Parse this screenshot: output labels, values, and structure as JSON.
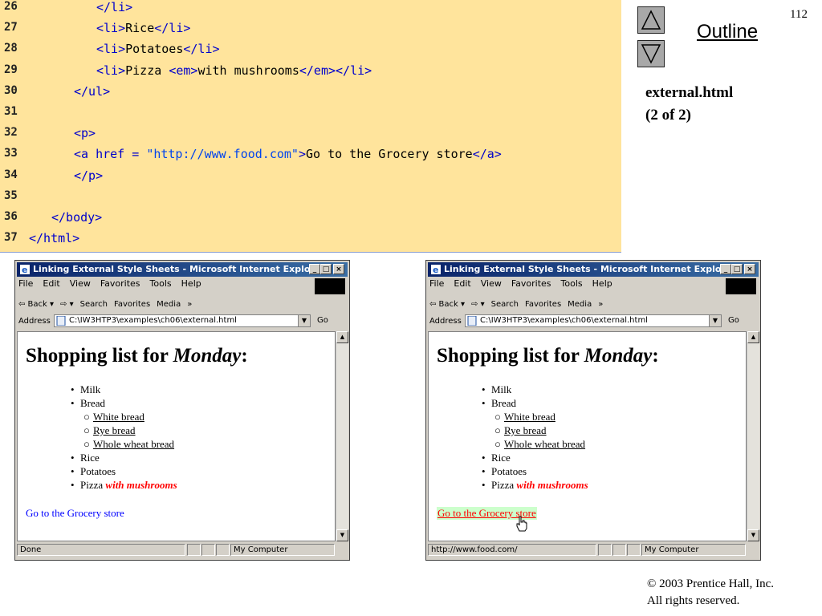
{
  "code": {
    "lines": [
      {
        "num": "26",
        "indent": 120,
        "parts": [
          {
            "t": "</li>",
            "c": "tag"
          }
        ]
      },
      {
        "num": "27",
        "indent": 120,
        "parts": [
          {
            "t": "<li>",
            "c": "tag"
          },
          {
            "t": "Rice",
            "c": "txt"
          },
          {
            "t": "</li>",
            "c": "tag"
          }
        ]
      },
      {
        "num": "28",
        "indent": 120,
        "parts": [
          {
            "t": "<li>",
            "c": "tag"
          },
          {
            "t": "Potatoes",
            "c": "txt"
          },
          {
            "t": "</li>",
            "c": "tag"
          }
        ]
      },
      {
        "num": "29",
        "indent": 120,
        "parts": [
          {
            "t": "<li>",
            "c": "tag"
          },
          {
            "t": "Pizza ",
            "c": "txt"
          },
          {
            "t": "<em>",
            "c": "tag"
          },
          {
            "t": "with mushrooms",
            "c": "txt"
          },
          {
            "t": "</em></li>",
            "c": "tag"
          }
        ]
      },
      {
        "num": "30",
        "indent": 92,
        "parts": [
          {
            "t": "</ul>",
            "c": "tag"
          }
        ]
      },
      {
        "num": "31",
        "indent": 92,
        "parts": []
      },
      {
        "num": "32",
        "indent": 92,
        "parts": [
          {
            "t": "<p>",
            "c": "tag"
          }
        ]
      },
      {
        "num": "33",
        "indent": 92,
        "parts": [
          {
            "t": "<a href = ",
            "c": "attr"
          },
          {
            "t": "\"http://www.food.com\"",
            "c": "str"
          },
          {
            "t": ">",
            "c": "tag"
          },
          {
            "t": "Go to the Grocery store",
            "c": "txt"
          },
          {
            "t": "</a>",
            "c": "tag"
          }
        ]
      },
      {
        "num": "34",
        "indent": 92,
        "parts": [
          {
            "t": "</p>",
            "c": "tag"
          }
        ]
      },
      {
        "num": "35",
        "indent": 92,
        "parts": []
      },
      {
        "num": "36",
        "indent": 64,
        "parts": [
          {
            "t": "</body>",
            "c": "tag"
          }
        ]
      },
      {
        "num": "37",
        "indent": 36,
        "parts": [
          {
            "t": "</html>",
            "c": "tag"
          }
        ]
      }
    ]
  },
  "nav": {
    "outline_label": "Outline",
    "page_number": "112",
    "file_title_line1": "external.html",
    "file_title_line2": "(2 of 2)"
  },
  "copyright": {
    "line1": "© 2003 Prentice Hall, Inc.",
    "line2": "All rights reserved."
  },
  "browser": {
    "title": "Linking External Style Sheets - Microsoft Internet Explorer",
    "menu": [
      "File",
      "Edit",
      "View",
      "Favorites",
      "Tools",
      "Help"
    ],
    "toolbar": [
      "⇦ Back ▾",
      "⇨ ▾",
      "Search",
      "Favorites",
      "Media",
      "»"
    ],
    "address_label": "Address",
    "address_value": "C:\\IW3HTP3\\examples\\ch06\\external.html",
    "go_label": "Go",
    "status_left": "Done",
    "status_left_hover": "http://www.food.com/",
    "status_zone": "My Computer"
  },
  "page": {
    "heading_prefix": "Shopping list for ",
    "heading_em": "Monday",
    "heading_suffix": ":",
    "items_l1_a": [
      "Milk",
      "Bread"
    ],
    "items_l2": [
      "White bread",
      "Rye bread",
      "Whole wheat bread"
    ],
    "items_l1_b": [
      "Rice",
      "Potatoes"
    ],
    "pizza_text": "Pizza ",
    "pizza_em": "with mushrooms",
    "link_text": "Go to the Grocery store"
  },
  "colors": {
    "code_bg": "#ffe49c",
    "code_tag": "#0000cc",
    "link_blue": "#0000ff",
    "hover_red": "#ff0000",
    "hover_bg": "#ccffcc"
  }
}
